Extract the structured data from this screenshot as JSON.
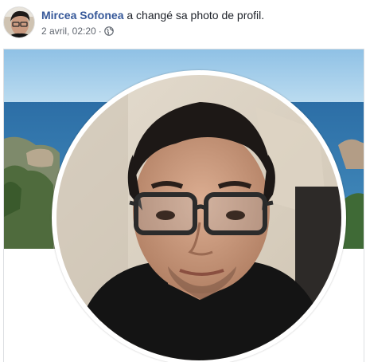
{
  "post": {
    "author_name": "Mircea Sofonea",
    "action_text": " a changé sa photo de profil.",
    "timestamp": "2 avril, 02:20",
    "separator": "·",
    "privacy_icon": "globe-icon"
  },
  "images": {
    "author_avatar": "portrait of man with glasses",
    "cover_photo": "sea and rocky coast landscape",
    "profile_photo": "portrait of man with dark hair and glasses"
  },
  "colors": {
    "author_link": "#365899",
    "meta_text": "#616770",
    "sea": "#2e6fa3",
    "sky": "#9cc8e6"
  }
}
